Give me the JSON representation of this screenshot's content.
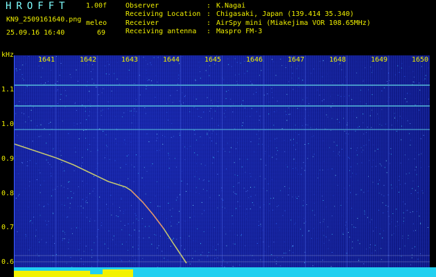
{
  "header": {
    "app_title": "HROFFT",
    "version": "1.00f",
    "filename": "KN9_2509161640.png",
    "unit_label": "meleo",
    "datetime": "25.09.16 16:40",
    "value": "69"
  },
  "meta": [
    {
      "key": "Observer",
      "sep": ":",
      "value": "K.Nagai"
    },
    {
      "key": "Receiving Location",
      "sep": ":",
      "value": "Chigasaki, Japan (139.414 35.340)"
    },
    {
      "key": "Receiver",
      "sep": ":",
      "value": "AirSpy mini (Miakejima VOR 108.65MHz)"
    },
    {
      "key": "Receiving antenna",
      "sep": ":",
      "value": "Maspro FM-3"
    }
  ],
  "axes": {
    "y_unit": "kHz",
    "y_labels": [
      "1.1",
      "1.0",
      "0.9",
      "0.8",
      "0.7",
      "0.6"
    ],
    "x_labels": [
      "1641",
      "1642",
      "1643",
      "1644",
      "1645",
      "1646",
      "1647",
      "1648",
      "1649",
      "1650"
    ]
  },
  "colors": {
    "background": "#000000",
    "label": "#f0f000",
    "title": "#7fffff",
    "trace": "#d8d86a",
    "reference_line": "#62d9e6",
    "footer": "#22d0f0",
    "footer_signal": "#f2f200"
  }
}
